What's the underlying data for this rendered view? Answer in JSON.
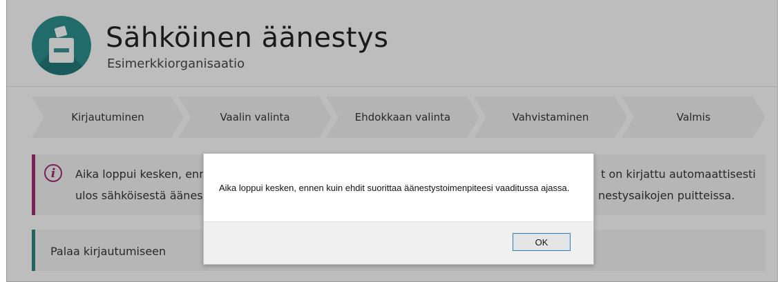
{
  "app": {
    "title": "Sähköinen äänestys",
    "organization": "Esimerkkiorganisaatio",
    "logo_icon": "ballot-box-icon",
    "brand_color": "#2b8b8a"
  },
  "steps": [
    "Kirjautuminen",
    "Vaalin valinta",
    "Ehdokkaan valinta",
    "Vahvistaminen",
    "Valmis"
  ],
  "notice": {
    "icon": "info-icon",
    "accent_color": "#9a2c6e",
    "line1_left": "Aika loppui kesken, enn",
    "line1_right": "t on kirjattu automaattisesti",
    "line2_left": "ulos sähköisestä äänest",
    "line2_right": "nestysaikojen puitteissa."
  },
  "back_link": {
    "label": "Palaa kirjautumiseen",
    "accent_color": "#2b7f7d"
  },
  "dialog": {
    "message": "Aika loppui kesken, ennen kuin ehdit suorittaa äänestystoimenpiteesi vaaditussa ajassa.",
    "ok_label": "OK"
  }
}
